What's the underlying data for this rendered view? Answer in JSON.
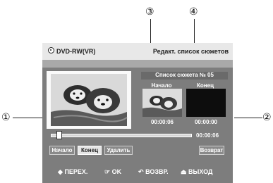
{
  "header": {
    "disc_type": "DVD-RW(VR)",
    "menu_title": "Редакт. список сюжетов"
  },
  "playlist": {
    "title": "Список сюжета № 05",
    "start_label": "Начало",
    "end_label": "Конец",
    "start_time": "00:00:06",
    "end_time": "00:00:00"
  },
  "timeline": {
    "current_time": "00:00:06",
    "progress": 0.03
  },
  "buttons": {
    "start": "Начало",
    "end": "Конец",
    "delete": "Удалить",
    "back": "Возврат"
  },
  "footer": {
    "move": "ПЕРЕХ.",
    "ok": "OK",
    "back": "ВОЗВР.",
    "exit": "ВЫХОД"
  },
  "callouts": [
    "①",
    "②",
    "③",
    "④"
  ]
}
